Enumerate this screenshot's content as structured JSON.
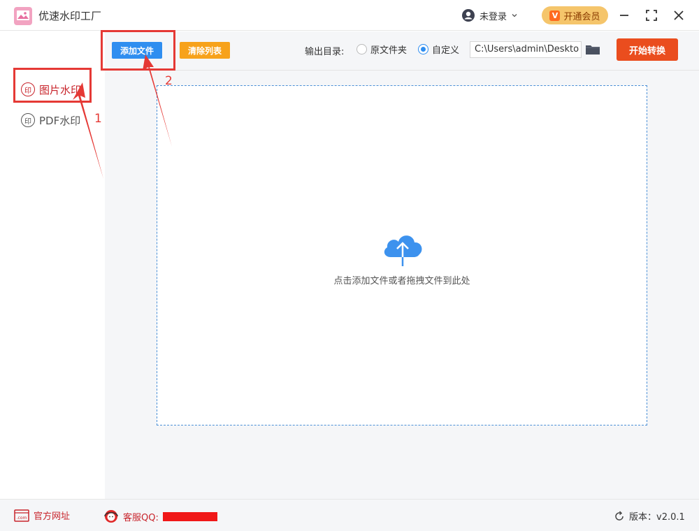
{
  "app": {
    "title": "优速水印工厂",
    "user_label": "未登录",
    "vip_label": "开通会员",
    "vip_badge": "V"
  },
  "sidebar": {
    "items": [
      {
        "label": "图片水印",
        "icon": "stamp-icon",
        "active": true
      },
      {
        "label": "PDF水印",
        "icon": "stamp-icon",
        "active": false
      }
    ],
    "stamp_glyph": "印"
  },
  "toolbar": {
    "add_label": "添加文件",
    "clear_label": "清除列表",
    "output_label": "输出目录:",
    "radio_original": "原文件夹",
    "radio_custom": "自定义",
    "selected_output": "自定义",
    "path_value": "C:\\Users\\admin\\Deskto",
    "start_label": "开始转换"
  },
  "dropzone": {
    "text": "点击添加文件或者拖拽文件到此处",
    "icon": "cloud-upload-icon"
  },
  "footer": {
    "website_label": "官方网址",
    "website_icon_text": ".com",
    "qq_label": "客服QQ:",
    "version_label": "版本：v2.0.1"
  },
  "annotations": {
    "step1": "1",
    "step2": "2"
  },
  "colors": {
    "accent_blue": "#2f8ef0",
    "clear_orange": "#f7a21b",
    "start_red": "#ea4d1e",
    "active_red": "#c8242b",
    "annotation_red": "#e53935",
    "vip_gold": "#f5c56b"
  }
}
